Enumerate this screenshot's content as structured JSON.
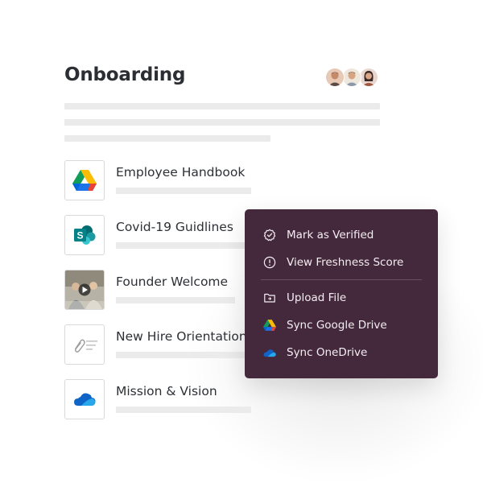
{
  "page": {
    "title": "Onboarding"
  },
  "avatars": [
    "avatar-1",
    "avatar-2",
    "avatar-3"
  ],
  "documents": [
    {
      "title": "Employee Handbook",
      "icon": "google-drive-icon"
    },
    {
      "title": "Covid-19 Guidlines",
      "icon": "sharepoint-icon"
    },
    {
      "title": "Founder Welcome",
      "icon": "video-thumbnail"
    },
    {
      "title": "New Hire Orientation",
      "icon": "attachment-icon"
    },
    {
      "title": "Mission & Vision",
      "icon": "onedrive-icon"
    }
  ],
  "menu": {
    "items": [
      {
        "label": "Mark as Verified",
        "icon": "verified-badge-icon"
      },
      {
        "label": "View Freshness Score",
        "icon": "info-icon"
      },
      {
        "label": "Upload File",
        "icon": "folder-icon"
      },
      {
        "label": "Sync Google Drive",
        "icon": "google-drive-icon"
      },
      {
        "label": "Sync OneDrive",
        "icon": "onedrive-icon"
      }
    ]
  },
  "colors": {
    "menu_background": "#44283c",
    "menu_text": "#f4eef2",
    "skeleton": "#ebebeb",
    "title_text": "#2b2e33"
  }
}
